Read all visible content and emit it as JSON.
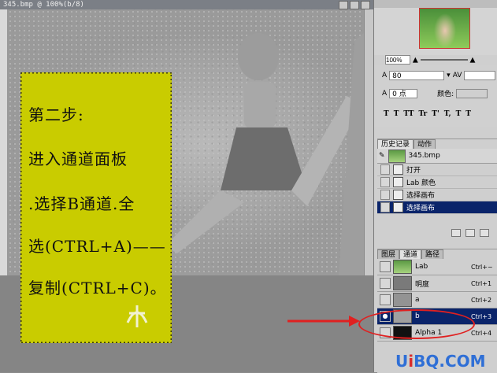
{
  "document": {
    "title": "345.bmp @ 100%(b/8)"
  },
  "note": {
    "lines": [
      "第二步:",
      "进入通道面板",
      ".选择B通道.全",
      "选(CTRL+A)——",
      "复制(CTRL+C)。"
    ]
  },
  "navigator": {
    "zoom": "100%"
  },
  "character": {
    "leading": "80",
    "tracking": "0 点",
    "color_label": "颜色:",
    "style_buttons": [
      "T",
      "T",
      "TT",
      "Tr",
      "T'",
      "T,",
      "T",
      "T"
    ]
  },
  "history": {
    "tabs": [
      "历史记录",
      "动作"
    ],
    "snapshot": "345.bmp",
    "items": [
      "打开",
      "Lab 颜色",
      "选择画布",
      "选择画布"
    ]
  },
  "channels": {
    "tabs": [
      "图层",
      "通道",
      "路径"
    ],
    "rows": [
      {
        "name": "Lab",
        "shortcut": "Ctrl+~"
      },
      {
        "name": "明度",
        "shortcut": "Ctrl+1"
      },
      {
        "name": "a",
        "shortcut": "Ctrl+2"
      },
      {
        "name": "b",
        "shortcut": "Ctrl+3"
      },
      {
        "name": "Alpha 1",
        "shortcut": "Ctrl+4"
      }
    ]
  },
  "watermark": {
    "prefix": "U",
    "accent": "i",
    "suffix": "BQ.COM"
  },
  "colors": {
    "note_bg": "#c9cc00",
    "selection": "#0a246a",
    "annotation": "#e02020"
  }
}
